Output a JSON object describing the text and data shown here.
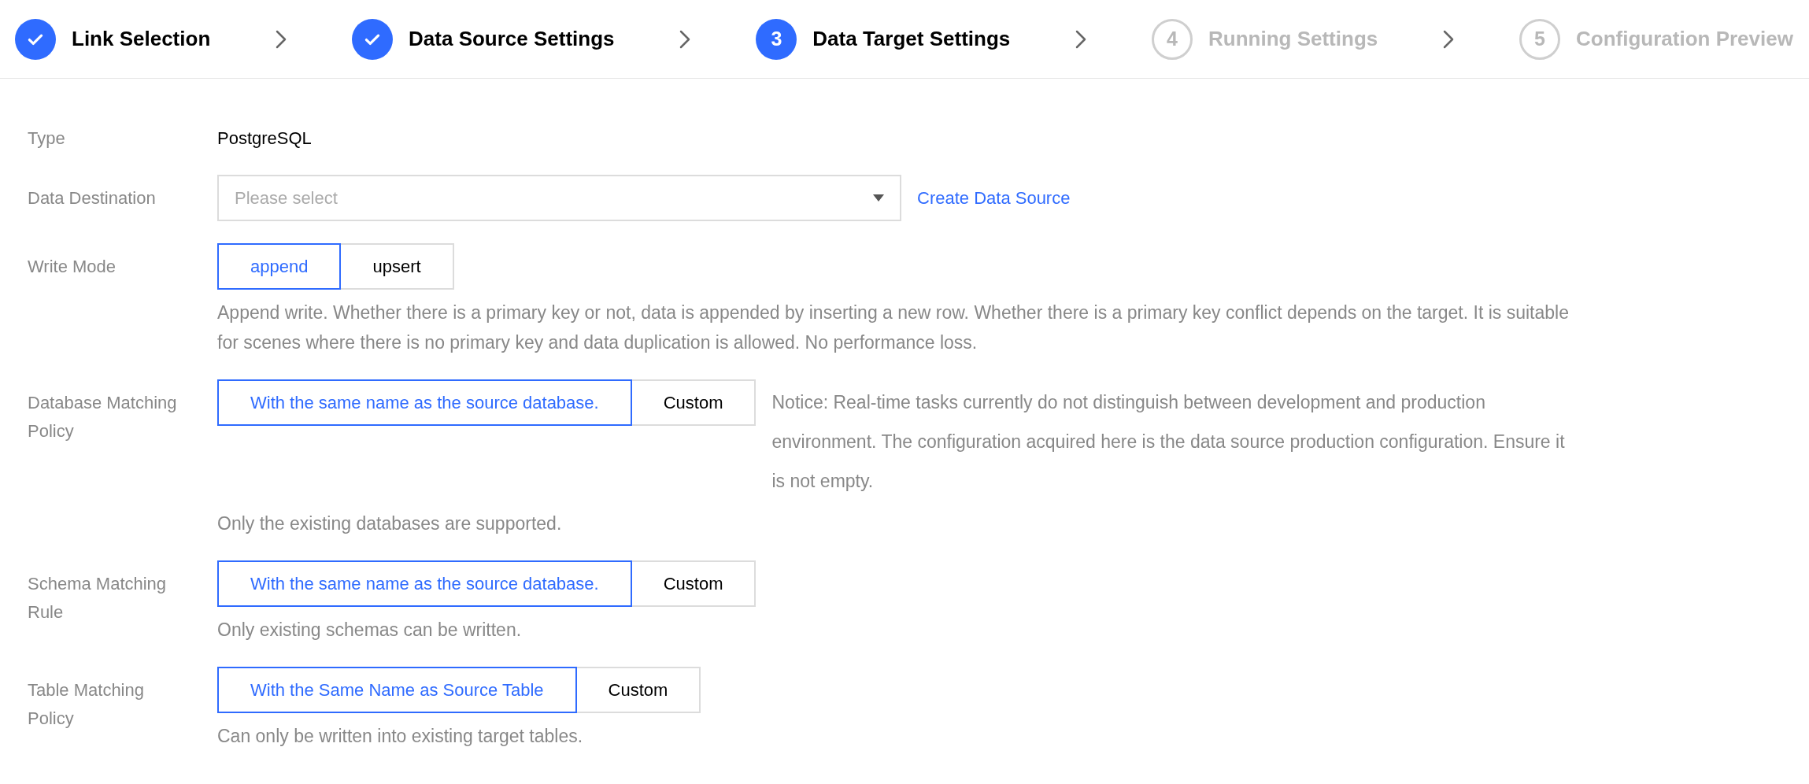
{
  "steps": [
    {
      "label": "Link Selection",
      "done": true,
      "selected": false
    },
    {
      "label": "Data Source Settings",
      "done": true,
      "selected": false
    },
    {
      "number": "3",
      "label": "Data Target Settings",
      "done": false,
      "selected": true
    },
    {
      "number": "4",
      "label": "Running Settings",
      "done": false,
      "selected": false
    },
    {
      "number": "5",
      "label": "Configuration Preview",
      "done": false,
      "selected": false
    }
  ],
  "form": [
    {
      "kind": "text",
      "label": "Type",
      "value": "PostgreSQL"
    },
    {
      "kind": "select",
      "label": "Data Destination",
      "placeholder": "Please select",
      "link": "Create Data Source"
    },
    {
      "kind": "segmented",
      "label": "Write Mode",
      "options": [
        {
          "label": "append",
          "selected": true
        },
        {
          "label": "upsert",
          "selected": false
        }
      ],
      "description": "Append write. Whether there is a primary key or not, data is appended by inserting a new row. Whether there is a primary key conflict depends on the target. It is suitable for scenes where there is no primary key and data duplication is allowed. No performance loss."
    },
    {
      "kind": "segmented",
      "label": "Database Matching Policy",
      "options": [
        {
          "label": "With the same name as the source database.",
          "selected": true
        },
        {
          "label": "Custom",
          "selected": false
        }
      ],
      "notice": "Notice: Real-time tasks currently do not distinguish between development and production environment. The configuration acquired here is the data source production configuration. Ensure it is not empty.",
      "description": "Only the existing databases are supported."
    },
    {
      "kind": "segmented",
      "label": "Schema Matching Rule",
      "options": [
        {
          "label": "With the same name as the source database.",
          "selected": true
        },
        {
          "label": "Custom",
          "selected": false
        }
      ],
      "description": "Only existing schemas can be written."
    },
    {
      "kind": "segmented",
      "label": "Table Matching Policy",
      "options": [
        {
          "label": "With the Same Name as Source Table",
          "selected": true
        },
        {
          "label": "Custom",
          "selected": false
        }
      ],
      "description": "Can only be written into existing target tables."
    }
  ]
}
